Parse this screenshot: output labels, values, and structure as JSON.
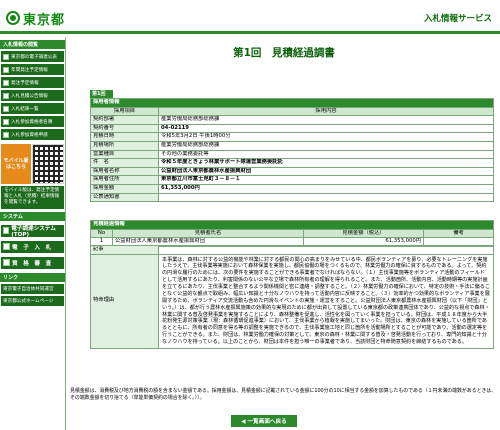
{
  "header": {
    "logo_text": "東京都",
    "service_title": "入札情報サービス"
  },
  "sidebar": {
    "section_title": "入札情報の閲覧",
    "items": [
      {
        "label": "東京都の電子調達公表"
      },
      {
        "label": "年間発注予定情報"
      },
      {
        "label": "発注予定情報"
      },
      {
        "label": "入札見積公告情報"
      },
      {
        "label": "入札結果一覧"
      },
      {
        "label": "入札参加資格者名簿"
      },
      {
        "label": "入札参加資格申請"
      }
    ],
    "promo_label": "モバイル版 はこちら",
    "promo_note": "モバイル版は、発注予定情報と入札（見積）結果情報を閲覧できます。",
    "system_title": "システム",
    "system_items": [
      {
        "label": "電子調達システム(TOP)"
      },
      {
        "label": "電　子　入　札"
      },
      {
        "label": "資　格　審　査"
      }
    ],
    "link_title": "リンク",
    "links": [
      {
        "label": "東京電子自治体共同運営"
      },
      {
        "label": "東京都公式ホームページ"
      }
    ]
  },
  "main": {
    "title": "第1回　見積経過調書",
    "section1": "第1回",
    "info_header": "採用者情報",
    "col_item": "採用項目",
    "col_content": "採用内容",
    "rows": [
      {
        "label": "契約部署",
        "value": "産業労働局総務部総務課"
      },
      {
        "label": "契約番号",
        "value": "04-02119"
      },
      {
        "label": "見積日時",
        "value": "令和5年3月2日 午後1時00分"
      },
      {
        "label": "見積場所",
        "value": "産業労働局総務部総務課"
      },
      {
        "label": "営業種目",
        "value": "その他の業務委託等"
      },
      {
        "label": "件　名",
        "value": "令和５年度ときょう林業サポート隊運営業務委託託"
      },
      {
        "label": "採用者名称",
        "value": "公益財団法人東京都農林水産振興財団"
      },
      {
        "label": "採用者住所",
        "value": "東京都立川市富士見町３－８－１"
      },
      {
        "label": "採用金額",
        "value": "61,353,000円"
      },
      {
        "label": "公表通知書",
        "value": ""
      }
    ],
    "bid_header": "見積経過情報",
    "bid_cols": {
      "no": "No",
      "name": "見積者氏名",
      "amount": "見積金額（税込）",
      "remarks": "備考"
    },
    "bids": [
      {
        "no": "1",
        "name": "公益財団法人東京都農林水産振興財団",
        "amount": "61,353,000円",
        "remarks": ""
      }
    ],
    "notes_label": "記事",
    "special_label": "特命理由",
    "special_text": "本事業は、森林に対する公益的機能や林業に対する都民の関心の高まりをみせている中、都民ボランティアを募り、必要なトレーニングを実施したうえで、主伐事業等実施において森林保業を実施し、都民協働の場をつくるもので、林業労働力の確保に資するものである。よって、契約の円滑な履行のためには、次の要件を実施することができる事業者でなければならない。（１）主伐事業施等をボランティア活動のフィールドとして活用するにあたり、利害関係のない公平な立場で森林所有者の理解を得られること。また、活動箇所、活動内容、活動時期等の実施計画を立てるにあたり、主伐事業と整合するよう関係機関と密に連絡・調整すること。（２）林業労働力の確保において、特定の技術・手法に偏ることなく公益的な観点で取組み、幅広い知識と十分なノウハウを持って活動内容に反映すること。（３）効率的かつ効果的なボランティア事業を展開するため、ボランティア交流活動も含めた円滑なイベントの実施・運営をすること。公益財団法人東京都農林水産振興財団（以下「財団」という。）は、都が行う農林水産振興施策の効果的な実現のために都が出資して設置している東京都の政策連携団体であり、公益的な視点で森林・林業に関する普及啓発事業を実施することにより、森林整備を促進し、活性化を図っていく事業を担っている。財団は、平成１８年度から大半花粉発生源対策事業（現：森林循環促進事業）において、主伐事業から植栽を実施してまいった。財団は、東京の森林を実施している箇所であるとともに、所有者の同意を得る等の調整を実施できるので、主伐事業施工地と同じ箇所を活動場所とすることが可能であり、活動の選定等を行うことができる。また、財団は、林業労働力確保の対策として、東京の森林・林業に関する普及・啓発活動を行っており、専門的知識と十分なノウハウを持っている。以上のことから、財団は本件を担う唯一の事業者であり、当該財団と特命随意契約を締結するものである。",
    "footnote": "見積金額は、消費税及び地方消費税の額を含まない金額である。採用金額は、見積金額に記載されている金額に100分の10に相当する金額を加算したものである（１円未満の端数があるときは、その端数金額を切り捨てる（単能単価契約の場合を除く。））。",
    "back_label": "◀ 一覧画面へ戻る"
  }
}
